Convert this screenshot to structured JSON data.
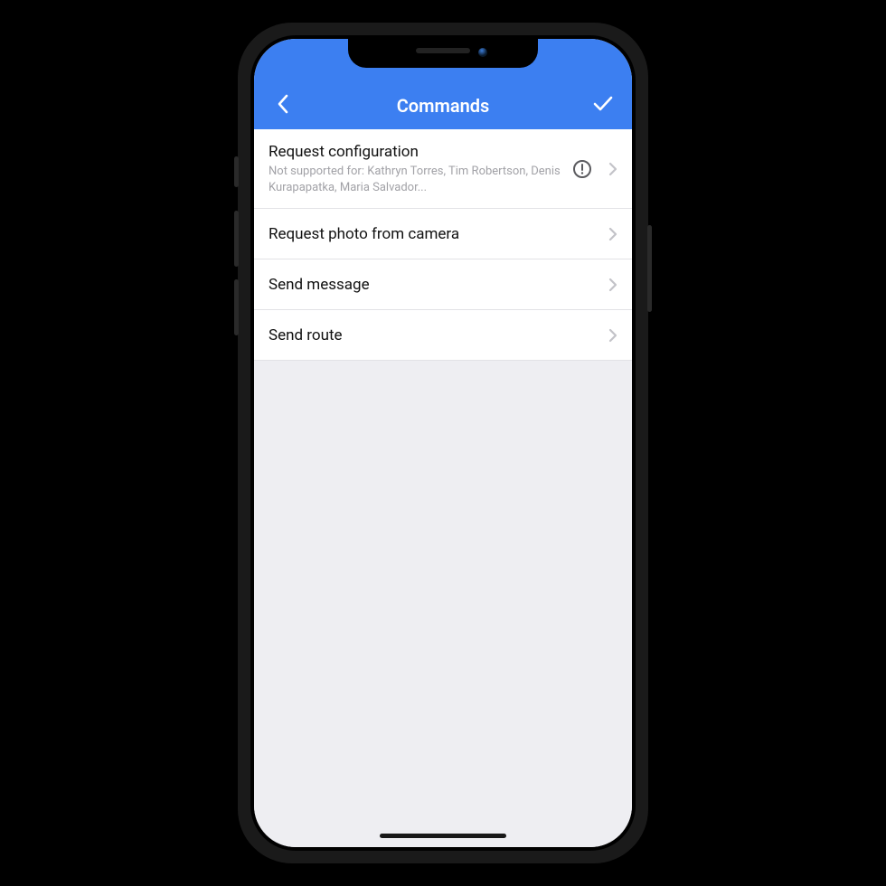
{
  "header": {
    "title": "Commands"
  },
  "commands": [
    {
      "title": "Request configuration",
      "subtitle": "Not supported for: Kathryn Torres, Tim Robertson, Denis Kurapapatka, Maria Salvador...",
      "warning": true
    },
    {
      "title": "Request photo from camera",
      "subtitle": "",
      "warning": false
    },
    {
      "title": "Send message",
      "subtitle": "",
      "warning": false
    },
    {
      "title": "Send route",
      "subtitle": "",
      "warning": false
    }
  ]
}
